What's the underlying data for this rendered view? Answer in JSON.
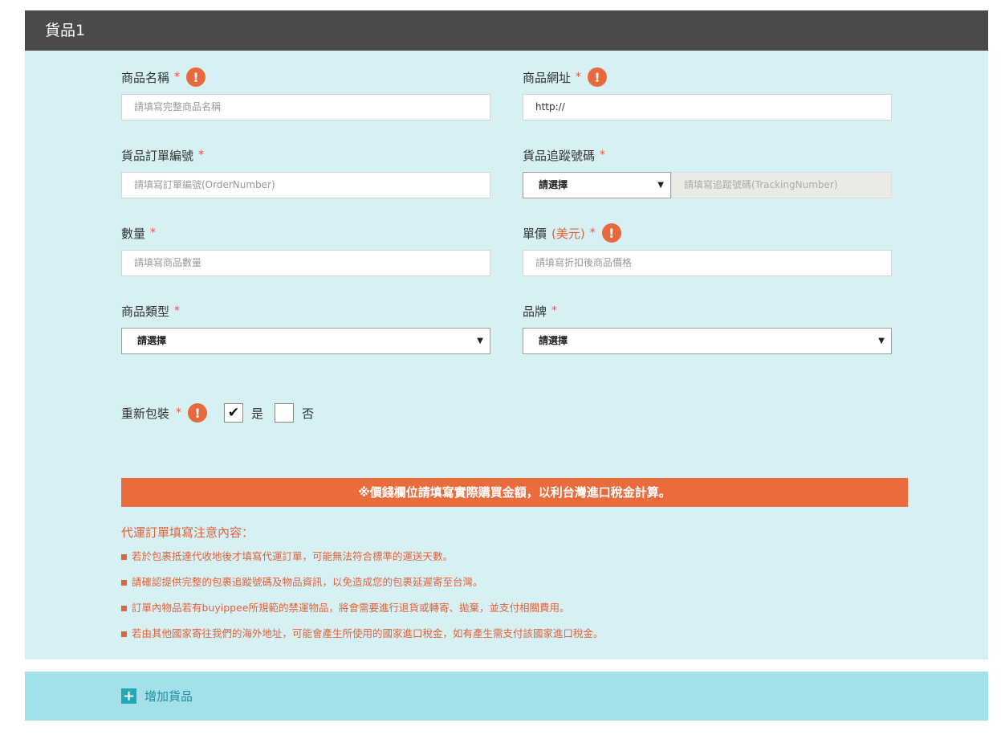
{
  "header": {
    "title": "貨品1"
  },
  "fields": {
    "product_name": {
      "label": "商品名稱",
      "required": "*",
      "placeholder": "請填寫完整商品名稱"
    },
    "product_url": {
      "label": "商品網址",
      "required": "*",
      "value": "http://"
    },
    "order_number": {
      "label": "貨品訂單編號",
      "required": "*",
      "placeholder": "請填寫訂單編號(OrderNumber)"
    },
    "tracking": {
      "label": "貨品追蹤號碼",
      "required": "*",
      "select_value": "請選擇",
      "placeholder": "請填寫追蹤號碼(TrackingNumber)"
    },
    "quantity": {
      "label": "數量",
      "required": "*",
      "placeholder": "請填寫商品數量"
    },
    "unit_price": {
      "label": "單價",
      "currency": "(美元)",
      "required": "*",
      "placeholder": "請填寫折扣後商品價格"
    },
    "category": {
      "label": "商品類型",
      "required": "*",
      "select_value": "請選擇"
    },
    "brand": {
      "label": "品牌",
      "required": "*",
      "select_value": "請選擇"
    }
  },
  "repack": {
    "label": "重新包裝",
    "required": "*",
    "yes_label": "是",
    "no_label": "否",
    "checked": "yes"
  },
  "icons": {
    "warn": "!",
    "check": "✔",
    "caret": "▼",
    "plus": "+"
  },
  "notice": {
    "text": "※價錢欄位請填寫實際購買金額，以利台灣進口稅金計算。"
  },
  "notes": {
    "title": "代運訂單填寫注意內容：",
    "items": [
      "若於包裹抵達代收地後才填寫代運訂單，可能無法符合標準的運送天數。",
      "請確認提供完整的包裹追蹤號碼及物品資訊，以免造成您的包裹延遲寄至台灣。",
      "訂單內物品若有buyippee所規範的禁運物品，將會需要進行退貨或轉寄、拋棄，並支付相關費用。",
      "若由其他國家寄往我們的海外地址，可能會產生所使用的國家進口稅金，如有產生需支付該國家進口稅金。"
    ]
  },
  "add_item": {
    "label": "增加貨品"
  },
  "colors": {
    "header_bg": "#4a4a4a",
    "body_bg": "#d7f0f4",
    "accent": "#ea6b3b",
    "add_bar_bg": "#a4e0e9"
  }
}
